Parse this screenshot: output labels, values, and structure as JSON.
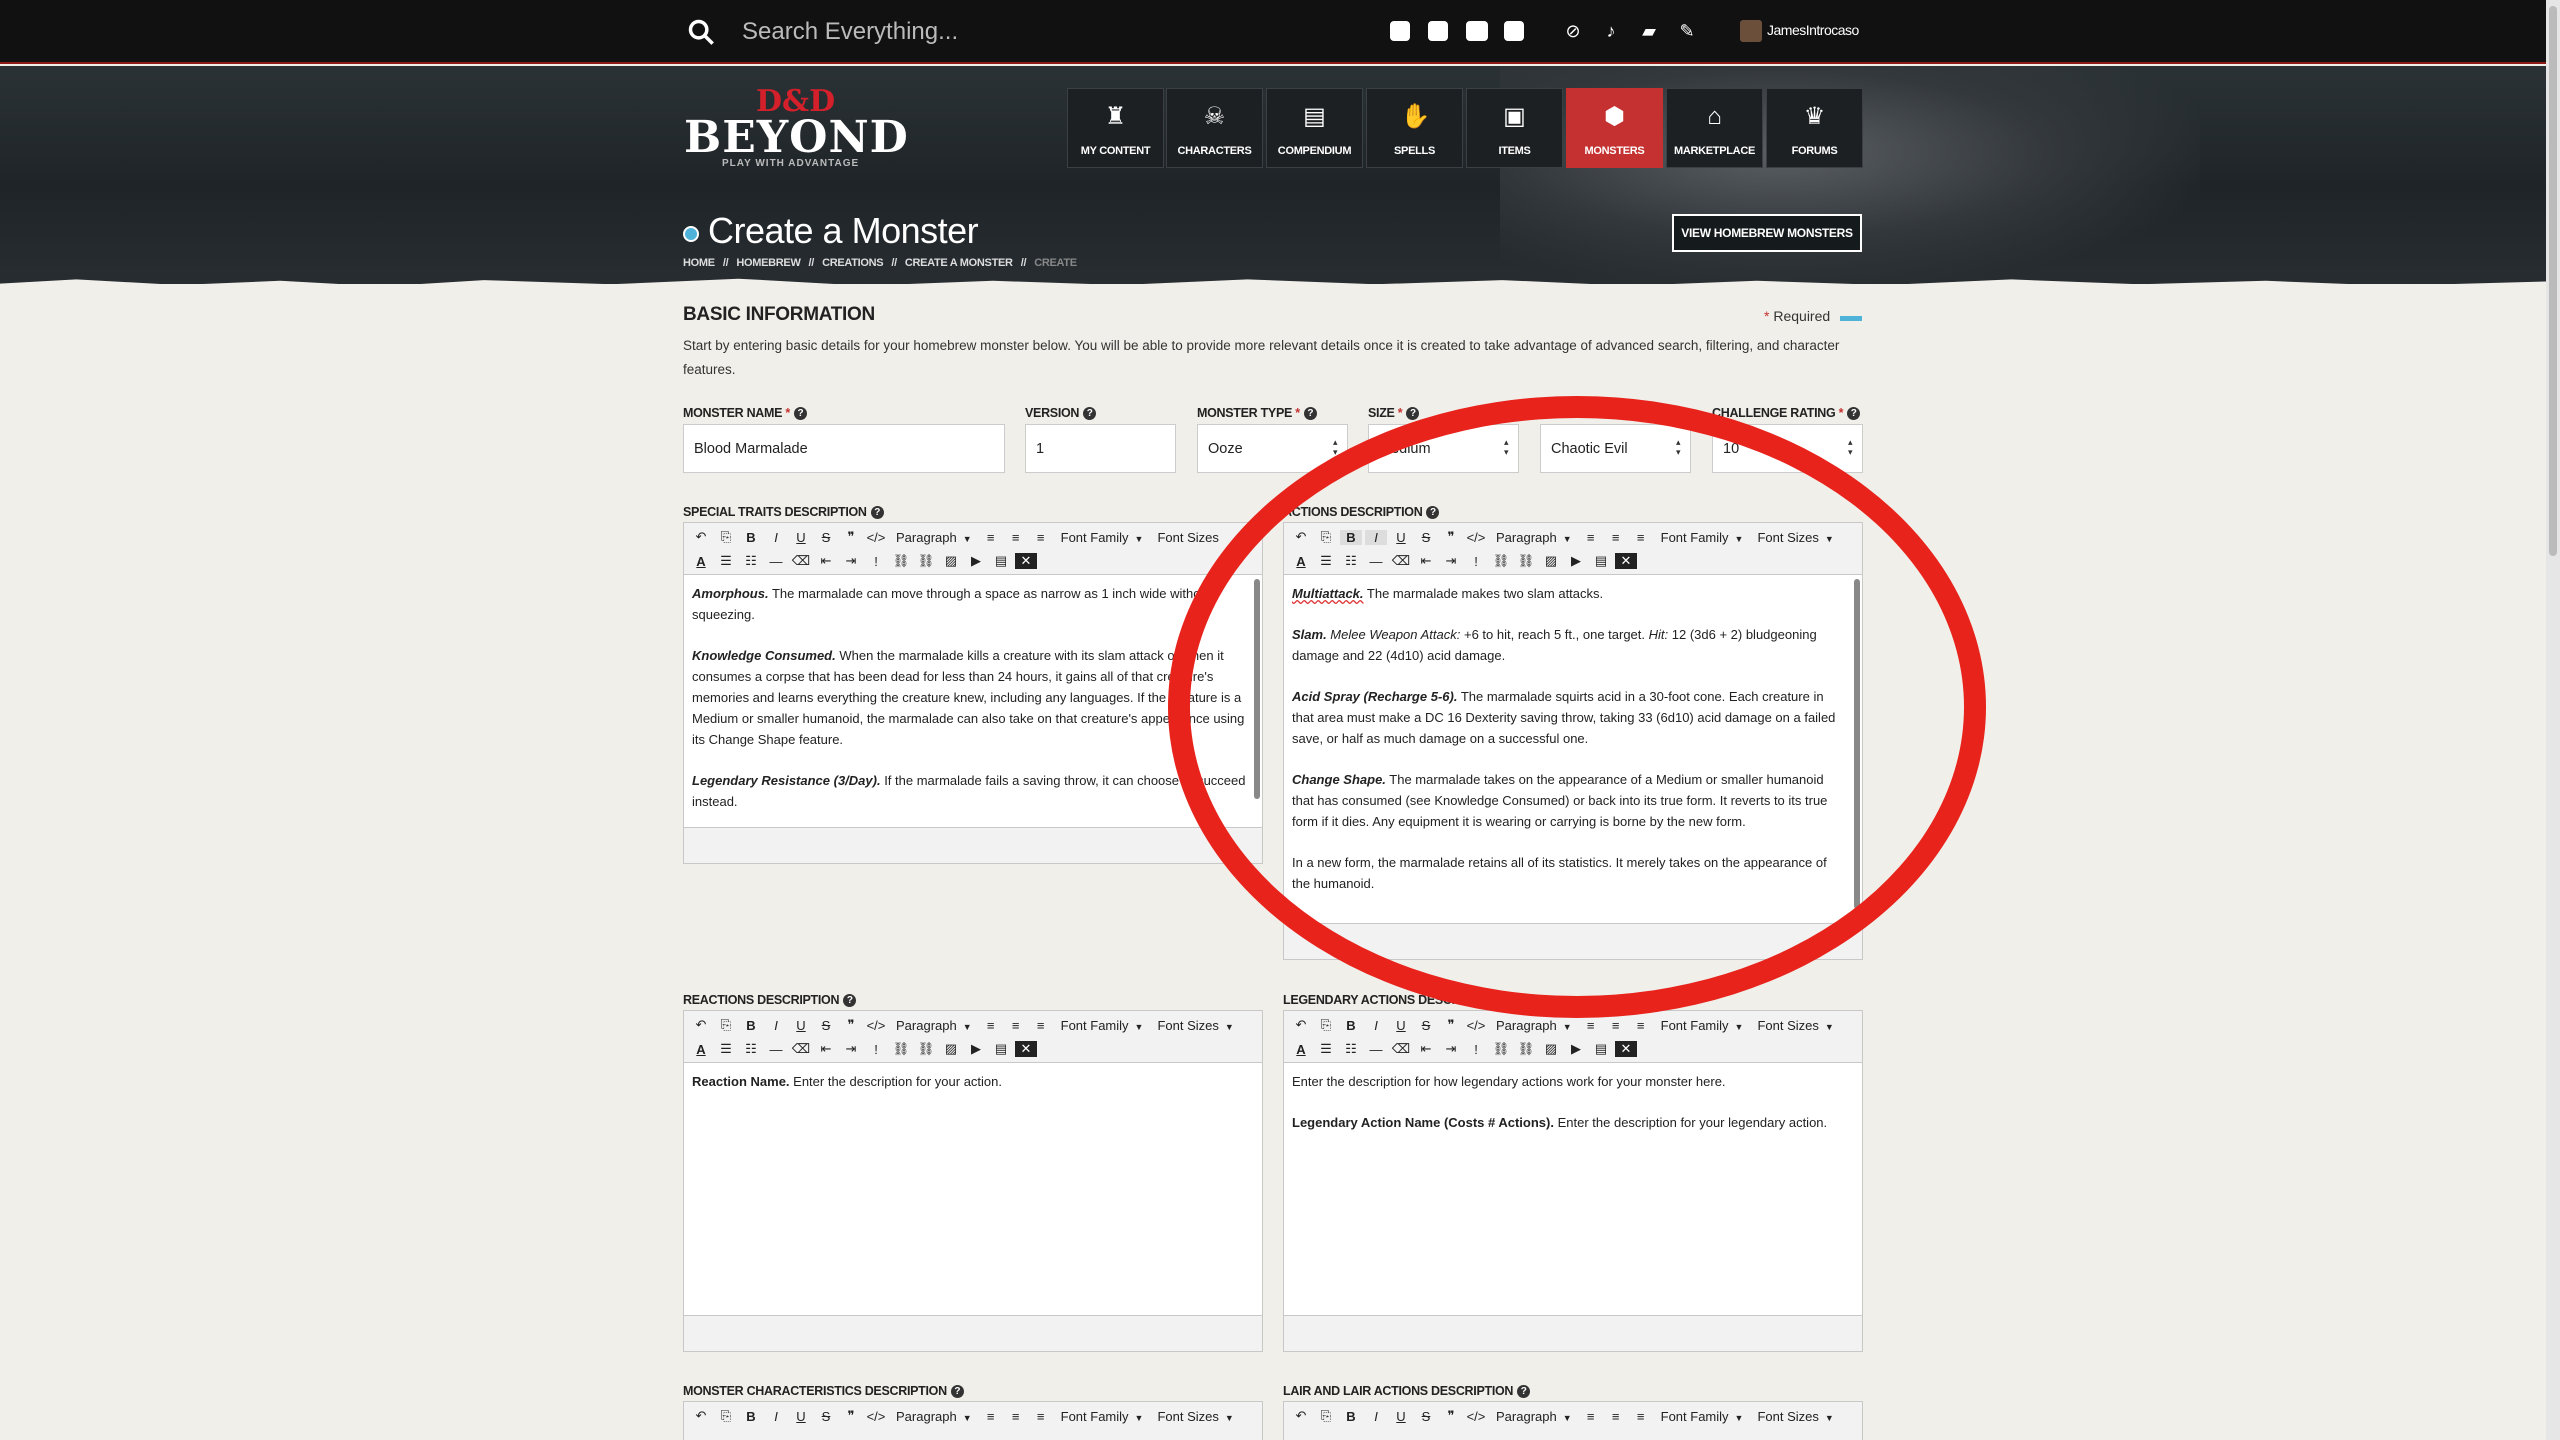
{
  "topbar": {
    "search_placeholder": "Search Everything...",
    "social": [
      "twitter-icon",
      "facebook-icon",
      "youtube-icon",
      "twitch-icon"
    ],
    "utility": [
      "no-ads-icon",
      "bell-icon",
      "chat-icon",
      "wrench-icon"
    ],
    "username": "JamesIntrocaso"
  },
  "logo": {
    "dnd": "D&D",
    "beyond": "BEYOND",
    "tagline": "PLAY WITH ADVANTAGE"
  },
  "nav": [
    {
      "label": "MY CONTENT",
      "icon": "bag-icon"
    },
    {
      "label": "CHARACTERS",
      "icon": "skull-crossbones-icon"
    },
    {
      "label": "COMPENDIUM",
      "icon": "book-icon"
    },
    {
      "label": "SPELLS",
      "icon": "hand-magic-icon"
    },
    {
      "label": "ITEMS",
      "icon": "chest-icon"
    },
    {
      "label": "MONSTERS",
      "icon": "monster-eye-icon",
      "active": true
    },
    {
      "label": "MARKETPLACE",
      "icon": "shop-icon"
    },
    {
      "label": "FORUMS",
      "icon": "forum-icon"
    }
  ],
  "page": {
    "title": "Create a Monster",
    "breadcrumb": [
      "HOME",
      "//",
      "HOMEBREW",
      "//",
      "CREATIONS",
      "//",
      "CREATE A MONSTER",
      "//",
      "CREATE"
    ],
    "view_button": "VIEW HOMEBREW MONSTERS"
  },
  "basic": {
    "title": "BASIC INFORMATION",
    "required_label": "Required",
    "intro": "Start by entering basic details for your homebrew monster below. You will be able to provide more relevant details once it is created to take advantage of advanced search, filtering, and character features."
  },
  "fields": [
    {
      "label": "MONSTER NAME",
      "required": true,
      "value": "Blood Marmalade"
    },
    {
      "label": "VERSION",
      "required": false,
      "value": "1"
    },
    {
      "label": "MONSTER TYPE",
      "required": true,
      "value": "Ooze"
    },
    {
      "label": "SIZE",
      "required": true,
      "value": "Medium"
    },
    {
      "label": "ALIGNMENT",
      "required": true,
      "value": "Chaotic Evil"
    },
    {
      "label": "CHALLENGE RATING",
      "required": true,
      "value": "10"
    }
  ],
  "toolbar": {
    "paragraph": "Paragraph",
    "font_family": "Font Family",
    "font_sizes": "Font Sizes"
  },
  "editors": {
    "special_traits": {
      "label": "SPECIAL TRAITS DESCRIPTION",
      "paras": [
        {
          "name": "Amorphous.",
          "text": " The marmalade can move through a space as narrow as 1 inch wide without squeezing."
        },
        {
          "name": "Knowledge Consumed.",
          "text": " When the marmalade kills a creature with its slam attack or when it consumes a corpse that has been dead for less than 24 hours, it gains all of that creature's memories and learns everything the creature knew, including any languages. If the creature is a Medium or smaller humanoid, the marmalade can also take on that creature's appearance using its Change Shape feature."
        },
        {
          "name": "Legendary Resistance (3/Day).",
          "text": " If the marmalade fails a saving throw, it can choose to succeed instead."
        }
      ]
    },
    "actions": {
      "label": "ACTIONS DESCRIPTION",
      "paras": [
        {
          "name": "Multiattack.",
          "text": " The marmalade makes two slam attacks."
        },
        {
          "name": "Slam.",
          "em": " Melee Weapon Attack:",
          "text": " +6 to hit, reach 5 ft., one target. ",
          "hit": "Hit:",
          "text2": " 12 (3d6 + 2) bludgeoning damage and 22 (4d10) acid damage."
        },
        {
          "name": "Acid Spray (Recharge 5-6).",
          "text": " The marmalade squirts acid in a 30-foot cone. Each creature in that area must make a DC 16 Dexterity saving throw, taking 33 (6d10) acid damage on a failed save, or half as much damage on a successful one."
        },
        {
          "name": "Change Shape.",
          "text": " The marmalade takes on the appearance of a Medium or smaller humanoid that has consumed (see Knowledge Consumed) or back into its true form. It reverts to its true form if it dies. Any equipment it is wearing or carrying is borne by the new form."
        },
        {
          "name": "",
          "text": "In a new form, the marmalade retains all of its statistics. It merely takes on the appearance of the humanoid."
        }
      ]
    },
    "reactions": {
      "label": "REACTIONS DESCRIPTION",
      "paras": [
        {
          "name": "Reaction Name.",
          "text": " Enter the description for your action."
        }
      ]
    },
    "legendary": {
      "label": "LEGENDARY ACTIONS DESCRIPTION",
      "paras": [
        {
          "name": "",
          "text": "Enter the description for how legendary actions work for your monster here."
        },
        {
          "name": "Legendary Action Name (Costs # Actions).",
          "text": " Enter the description for your legendary action."
        }
      ]
    },
    "characteristics": {
      "label": "MONSTER CHARACTERISTICS DESCRIPTION"
    },
    "lair": {
      "label": "LAIR AND LAIR ACTIONS DESCRIPTION"
    }
  },
  "colors": {
    "accent": "#c53131",
    "blue": "#4fb3d9",
    "annotation": "#e8231c"
  }
}
